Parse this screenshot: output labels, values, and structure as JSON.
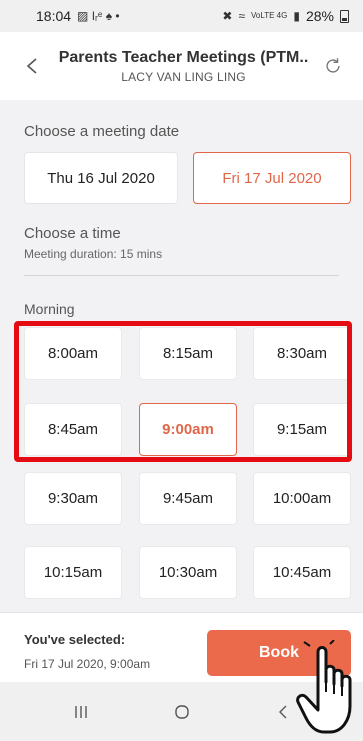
{
  "status_bar": {
    "time": "18:04",
    "left_icons": "▨ Іᵣᵉ ♠ •",
    "network": "VoLTE 4G",
    "battery": "28%"
  },
  "header": {
    "title": "Parents Teacher Meetings (PTM..",
    "subtitle": "LACY VAN LING LING"
  },
  "date_section": {
    "label": "Choose a meeting date",
    "dates": [
      {
        "label": "Thu 16 Jul 2020",
        "selected": false
      },
      {
        "label": "Fri 17 Jul 2020",
        "selected": true
      }
    ]
  },
  "time_section": {
    "label": "Choose a time",
    "duration": "Meeting duration: 15 mins"
  },
  "morning": {
    "label": "Morning",
    "slots": [
      {
        "label": "8:00am",
        "selected": false
      },
      {
        "label": "8:15am",
        "selected": false
      },
      {
        "label": "8:30am",
        "selected": false
      },
      {
        "label": "8:45am",
        "selected": false
      },
      {
        "label": "9:00am",
        "selected": true
      },
      {
        "label": "9:15am",
        "selected": false
      },
      {
        "label": "9:30am",
        "selected": false
      },
      {
        "label": "9:45am",
        "selected": false
      },
      {
        "label": "10:00am",
        "selected": false
      },
      {
        "label": "10:15am",
        "selected": false
      },
      {
        "label": "10:30am",
        "selected": false
      },
      {
        "label": "10:45am",
        "selected": false
      }
    ]
  },
  "footer": {
    "selected_label": "You've selected:",
    "selected_value": "Fri 17 Jul 2020, 9:00am",
    "book_label": "Book"
  },
  "colors": {
    "accent": "#e0674a",
    "book_button": "#ea6a4b",
    "highlight": "#e50b12"
  },
  "icons": [
    "back-chevron-icon",
    "refresh-icon",
    "recent-apps-icon",
    "home-icon",
    "nav-back-icon",
    "pointing-hand-icon"
  ]
}
